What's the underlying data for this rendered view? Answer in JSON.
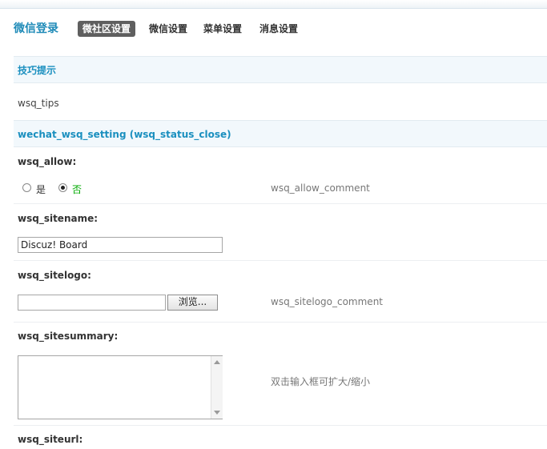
{
  "header": {
    "title": "微信登录",
    "tabs": [
      {
        "label": "微社区设置",
        "active": true
      },
      {
        "label": "微信设置",
        "active": false
      },
      {
        "label": "菜单设置",
        "active": false
      },
      {
        "label": "消息设置",
        "active": false
      }
    ]
  },
  "tips": {
    "heading": "技巧提示",
    "text": "wsq_tips"
  },
  "settings": {
    "heading": "wechat_wsq_setting (wsq_status_close)",
    "wsq_allow": {
      "label": "wsq_allow:",
      "options": [
        "是",
        "否"
      ],
      "selected": "否",
      "comment": "wsq_allow_comment"
    },
    "wsq_sitename": {
      "label": "wsq_sitename:",
      "value": "Discuz! Board"
    },
    "wsq_sitelogo": {
      "label": "wsq_sitelogo:",
      "value": "",
      "browse_label": "浏览...",
      "comment": "wsq_sitelogo_comment"
    },
    "wsq_sitesummary": {
      "label": "wsq_sitesummary:",
      "value": "",
      "comment": "双击输入框可扩大/缩小"
    },
    "wsq_siteurl": {
      "label": "wsq_siteurl:"
    }
  },
  "colors": {
    "accent": "#1f8bb8",
    "section_bg": "#f2f8fc",
    "active_tab_bg": "#5f5f5f",
    "selected_option": "#00aa00"
  }
}
